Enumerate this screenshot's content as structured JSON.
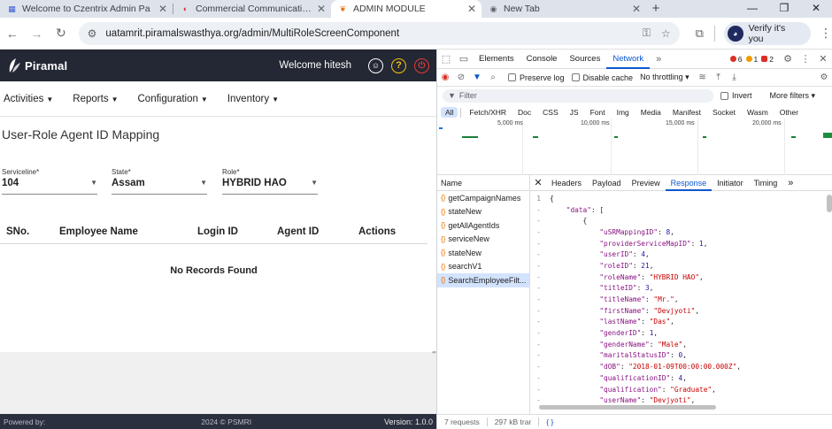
{
  "browser": {
    "tabs": [
      {
        "title": "Welcome to Czentrix Admin Pa",
        "fav": "▦",
        "fav_color": "#3b5bdb",
        "active": false
      },
      {
        "title": "Commercial Communication Pl",
        "fav": "◐",
        "fav_color": "#d93025",
        "active": false
      },
      {
        "title": "ADMIN MODULE",
        "fav": "❦",
        "fav_color": "#e8710a",
        "active": true
      },
      {
        "title": "New Tab",
        "fav": "◉",
        "fav_color": "#5f6368",
        "active": false
      }
    ],
    "url": "uatamrit.piramalswasthya.org/admin/MultiRoleScreenComponent",
    "verify_label": "Verify it's you"
  },
  "app": {
    "brand": "Piramal",
    "welcome": "Welcome hitesh",
    "menu": [
      "Activities",
      "Reports",
      "Configuration",
      "Inventory"
    ],
    "page_title": "User-Role Agent ID Mapping",
    "fields": {
      "serviceline": {
        "label": "Serviceline*",
        "value": "104"
      },
      "state": {
        "label": "State*",
        "value": "Assam"
      },
      "role": {
        "label": "Role*",
        "value": "HYBRID HAO"
      }
    },
    "table_headers": [
      "SNo.",
      "Employee Name",
      "Login ID",
      "Agent ID",
      "Actions"
    ],
    "empty_text": "No Records Found",
    "footer": {
      "powered": "Powered by:",
      "copyright": "2024 © PSMRI",
      "version": "Version: 1.0.0"
    }
  },
  "devtools": {
    "tabs": [
      "Elements",
      "Console",
      "Sources",
      "Network"
    ],
    "active_tab": "Network",
    "errors": "6",
    "warnings": "1",
    "issues": "2",
    "preserve_log": "Preserve log",
    "disable_cache": "Disable cache",
    "throttling": "No throttling",
    "filter_placeholder": "Filter",
    "invert": "Invert",
    "more_filters": "More filters",
    "types": [
      "All",
      "Fetch/XHR",
      "Doc",
      "CSS",
      "JS",
      "Font",
      "Img",
      "Media",
      "Manifest",
      "Socket",
      "Wasm",
      "Other"
    ],
    "timeline_labels": [
      "5,000 ms",
      "10,000 ms",
      "15,000 ms",
      "20,000 ms"
    ],
    "name_header": "Name",
    "requests": [
      "getCampaignNames",
      "stateNew",
      "getAllAgentIds",
      "serviceNew",
      "stateNew",
      "searchV1",
      "SearchEmployeeFilt..."
    ],
    "detail_tabs": [
      "Headers",
      "Payload",
      "Preview",
      "Response",
      "Initiator",
      "Timing"
    ],
    "active_detail_tab": "Response",
    "response": [
      {
        "ln": "1",
        "t": "{"
      },
      {
        "ln": "-",
        "t": "    \"data\": ["
      },
      {
        "ln": "-",
        "t": "        {"
      },
      {
        "ln": "-",
        "t": "            \"uSRMappingID\": 8,"
      },
      {
        "ln": "-",
        "t": "            \"providerServiceMapID\": 1,"
      },
      {
        "ln": "-",
        "t": "            \"userID\": 4,"
      },
      {
        "ln": "-",
        "t": "            \"roleID\": 21,"
      },
      {
        "ln": "-",
        "t": "            \"roleName\": \"HYBRID HAO\","
      },
      {
        "ln": "-",
        "t": "            \"titleID\": 3,"
      },
      {
        "ln": "-",
        "t": "            \"titleName\": \"Mr.\","
      },
      {
        "ln": "-",
        "t": "            \"firstName\": \"Devjyoti\","
      },
      {
        "ln": "-",
        "t": "            \"lastName\": \"Das\","
      },
      {
        "ln": "-",
        "t": "            \"genderID\": 1,"
      },
      {
        "ln": "-",
        "t": "            \"genderName\": \"Male\","
      },
      {
        "ln": "-",
        "t": "            \"maritalStatusID\": 0,"
      },
      {
        "ln": "-",
        "t": "            \"dOB\": \"2018-01-09T00:00:00.000Z\","
      },
      {
        "ln": "-",
        "t": "            \"qualificationID\": 4,"
      },
      {
        "ln": "-",
        "t": "            \"qualification\": \"Graduate\","
      },
      {
        "ln": "-",
        "t": "            \"userName\": \"Devjyoti\","
      }
    ],
    "status_requests": "7 requests",
    "status_transferred": "297 kB trar"
  }
}
